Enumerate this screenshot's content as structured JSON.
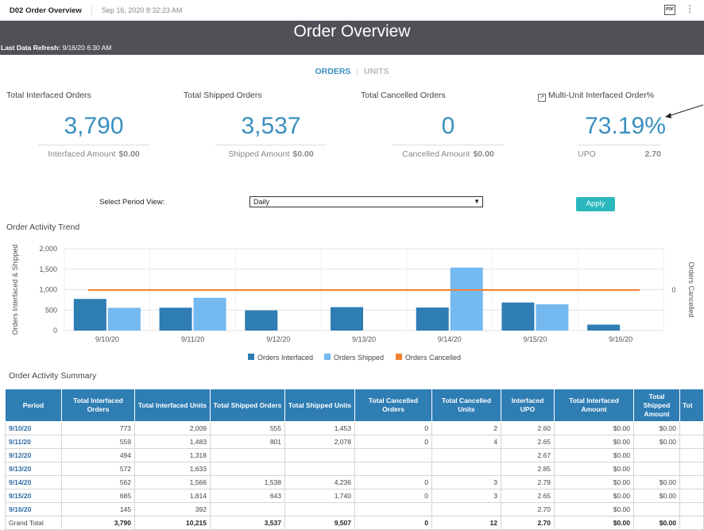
{
  "topbar": {
    "report_name": "D02 Order Overview",
    "timestamp": "Sep 16, 2020 8:32:23 AM",
    "pdf_label": "PDF"
  },
  "banner": {
    "title": "Order Overview",
    "refresh_label": "Last Data Refresh:",
    "refresh_value": "9/16/20 6:30 AM"
  },
  "toggle": {
    "orders": "ORDERS",
    "separator": "|",
    "units": "UNITS",
    "active": "ORDERS"
  },
  "kpis": [
    {
      "label": "Total Interfaced Orders",
      "value": "3,790",
      "sub_label": "Interfaced Amount",
      "sub_value": "$0.00"
    },
    {
      "label": "Total Shipped Orders",
      "value": "3,537",
      "sub_label": "Shipped Amount",
      "sub_value": "$0.00"
    },
    {
      "label": "Total Cancelled Orders",
      "value": "0",
      "sub_label": "Cancelled Amount",
      "sub_value": "$0.00"
    },
    {
      "label": "Multi-Unit Interfaced Order%",
      "value": "73.19%",
      "sub_label": "UPO",
      "sub_value": "2.70"
    }
  ],
  "period": {
    "label": "Select Period View:",
    "selected": "Daily",
    "apply": "Apply"
  },
  "trend": {
    "title": "Order Activity Trend"
  },
  "summary_title": "Order Activity Summary",
  "colors": {
    "interfaced": "#2e7db3",
    "shipped": "#74b9f0",
    "cancelled": "#f0822f",
    "accent": "#3a8fbf",
    "banner": "#505157",
    "apply": "#2bb7be"
  },
  "chart_data": {
    "type": "bar",
    "categories": [
      "9/10/20",
      "9/11/20",
      "9/12/20",
      "9/13/20",
      "9/14/20",
      "9/15/20",
      "9/16/20"
    ],
    "series": [
      {
        "name": "Orders Interfaced",
        "type": "bar",
        "axis": "left",
        "values": [
          773,
          559,
          494,
          572,
          562,
          685,
          145
        ]
      },
      {
        "name": "Orders Shipped",
        "type": "bar",
        "axis": "left",
        "values": [
          555,
          801,
          null,
          null,
          1538,
          643,
          null
        ]
      },
      {
        "name": "Orders Cancelled",
        "type": "line",
        "axis": "right",
        "values": [
          0,
          0,
          0,
          0,
          0,
          0,
          0
        ]
      }
    ],
    "ylabel": "Orders Interfaced & Shipped",
    "y2label": "Orders Cancelled",
    "ylim": [
      0,
      2000
    ],
    "yticks": [
      "2,000",
      "1,500",
      "1,000",
      "500",
      "0"
    ],
    "y2ticks": [
      "0"
    ],
    "legend": "bottom",
    "grid": true
  },
  "table": {
    "columns": [
      "Period",
      "Total Interfaced Orders",
      "Total Interfaced Units",
      "Total Shipped Orders",
      "Total Shipped Units",
      "Total Cancelled Orders",
      "Total Cancelled Units",
      "Interfaced UPO",
      "Total Interfaced Amount",
      "Total Shipped Amount",
      "Tot"
    ],
    "rows": [
      [
        "9/10/20",
        "773",
        "2,009",
        "555",
        "1,453",
        "0",
        "2",
        "2.60",
        "$0.00",
        "$0.00",
        ""
      ],
      [
        "9/11/20",
        "559",
        "1,483",
        "801",
        "2,078",
        "0",
        "4",
        "2.65",
        "$0.00",
        "$0.00",
        ""
      ],
      [
        "9/12/20",
        "494",
        "1,318",
        "",
        "",
        "",
        "",
        "2.67",
        "$0.00",
        "",
        ""
      ],
      [
        "9/13/20",
        "572",
        "1,633",
        "",
        "",
        "",
        "",
        "2.85",
        "$0.00",
        "",
        ""
      ],
      [
        "9/14/20",
        "562",
        "1,566",
        "1,538",
        "4,236",
        "0",
        "3",
        "2.79",
        "$0.00",
        "$0.00",
        ""
      ],
      [
        "9/15/20",
        "685",
        "1,814",
        "643",
        "1,740",
        "0",
        "3",
        "2.65",
        "$0.00",
        "$0.00",
        ""
      ],
      [
        "9/16/20",
        "145",
        "392",
        "",
        "",
        "",
        "",
        "2.70",
        "$0.00",
        "",
        ""
      ]
    ],
    "total": [
      "Grand Total",
      "3,790",
      "10,215",
      "3,537",
      "9,507",
      "0",
      "12",
      "2.70",
      "$0.00",
      "$0.00",
      ""
    ]
  }
}
